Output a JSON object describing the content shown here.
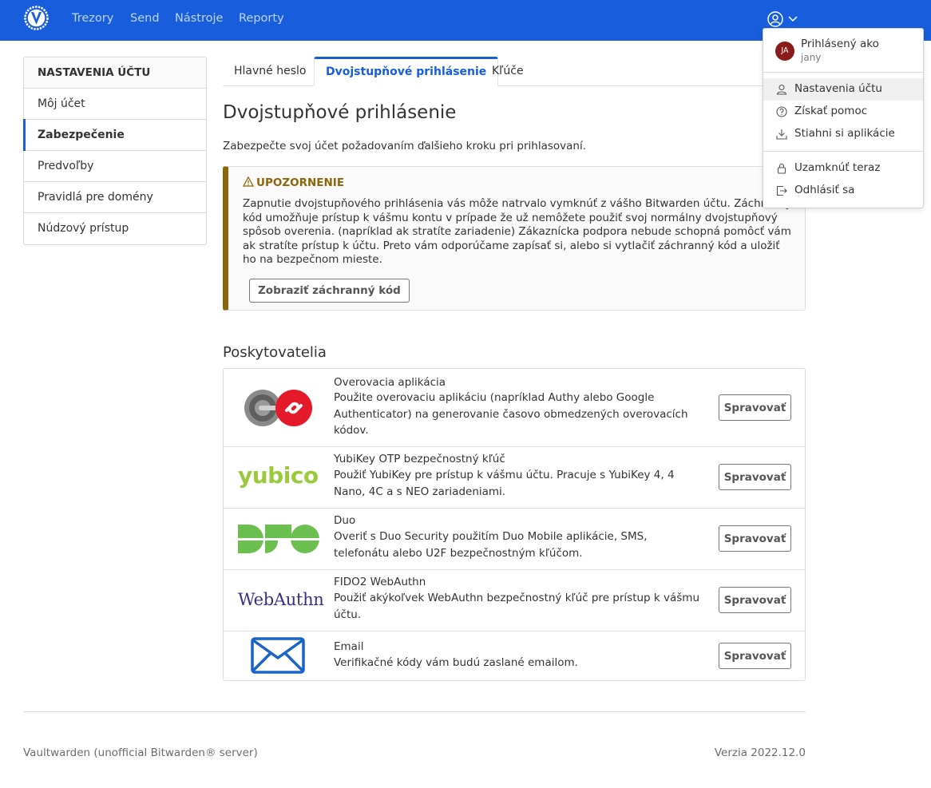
{
  "nav": {
    "links": [
      "Trezory",
      "Send",
      "Nástroje",
      "Reporty"
    ],
    "brand_color": "#175ddc"
  },
  "sidebar": {
    "header": "NASTAVENIA ÚČTU",
    "items": [
      {
        "label": "Môj účet",
        "active": false
      },
      {
        "label": "Zabezpečenie",
        "active": true
      },
      {
        "label": "Predvoľby",
        "active": false
      },
      {
        "label": "Pravidlá pre domény",
        "active": false
      },
      {
        "label": "Núdzový prístup",
        "active": false
      }
    ]
  },
  "tabs": [
    {
      "label": "Hlavné heslo",
      "active": false
    },
    {
      "label": "Dvojstupňové prihlásenie",
      "active": true
    },
    {
      "label": "Kľúče",
      "active": false
    }
  ],
  "main": {
    "title": "Dvojstupňové prihlásenie",
    "lead": "Zabezpečte svoj účet požadovaním ďalšieho kroku pri prihlasovaní."
  },
  "warning": {
    "title": "UPOZORNENIE",
    "icon": "warning-triangle-icon",
    "body": "Zapnutie dvojstupňového prihlásenia vás môže natrvalo vymknúť z vášho Bitwarden účtu. Záchranný kód umožňuje prístup k vášmu kontu v prípade že už nemôžete použiť svoj normálny dvojstupňový spôsob overenia. (napríklad ak stratíte zariadenie) Zákaznícka podpora nebude schopná pomôcť vám ak stratíte prístup k účtu. Preto vám odporúčame zapísať si, alebo si vytlačiť záchranný kód a uložiť ho na bezpečnom mieste.",
    "button": "Zobraziť záchranný kód",
    "accent": "#8b6609"
  },
  "providers": {
    "title": "Poskytovatelia",
    "items": [
      {
        "name": "Overovacia aplikácia",
        "desc": "Použite overovaciu aplikáciu (napríklad Authy alebo Google Authenticator) na generovanie časovo obmedzených overovacích kódov.",
        "button": "Spravovať",
        "logo": "authenticator-logo"
      },
      {
        "name": "YubiKey OTP bezpečnostný kľúč",
        "desc": "Použiť YubiKey pre prístup k vášmu účtu. Pracuje s YubiKey 4, 4 Nano, 4C a s NEO zariadeniami.",
        "button": "Spravovať",
        "logo_text": "yubico"
      },
      {
        "name": "Duo",
        "desc": "Overiť s Duo Security použitím Duo Mobile aplikácie, SMS, telefonátu alebo U2F bezpečnostným kľúčom.",
        "button": "Spravovať",
        "logo_text": "DUO"
      },
      {
        "name": "FIDO2 WebAuthn",
        "desc": "Použiť akýkoľvek WebAuthn bezpečnostný kľúč pre prístup k vášmu účtu.",
        "button": "Spravovať",
        "logo_text": "WebAuthn"
      },
      {
        "name": "Email",
        "desc": "Verifikačné kódy vám budú zaslané emailom.",
        "button": "Spravovať",
        "logo": "envelope-icon"
      }
    ]
  },
  "footer": {
    "left": "Vaultwarden (unofficial Bitwarden® server)",
    "right": "Verzia 2022.12.0"
  },
  "account_menu": {
    "avatar_initials": "JA",
    "avatar_color": "#8b1a1a",
    "logged_in_label": "Prihlásený ako",
    "username": "jany",
    "items": [
      {
        "label": "Nastavenia účtu",
        "icon": "user-icon"
      },
      {
        "label": "Získať pomoc",
        "icon": "question-circle-icon"
      },
      {
        "label": "Stiahni si aplikácie",
        "icon": "download-icon"
      },
      {
        "label": "Uzamknúť teraz",
        "icon": "lock-icon"
      },
      {
        "label": "Odhlásiť sa",
        "icon": "sign-out-icon"
      }
    ]
  }
}
